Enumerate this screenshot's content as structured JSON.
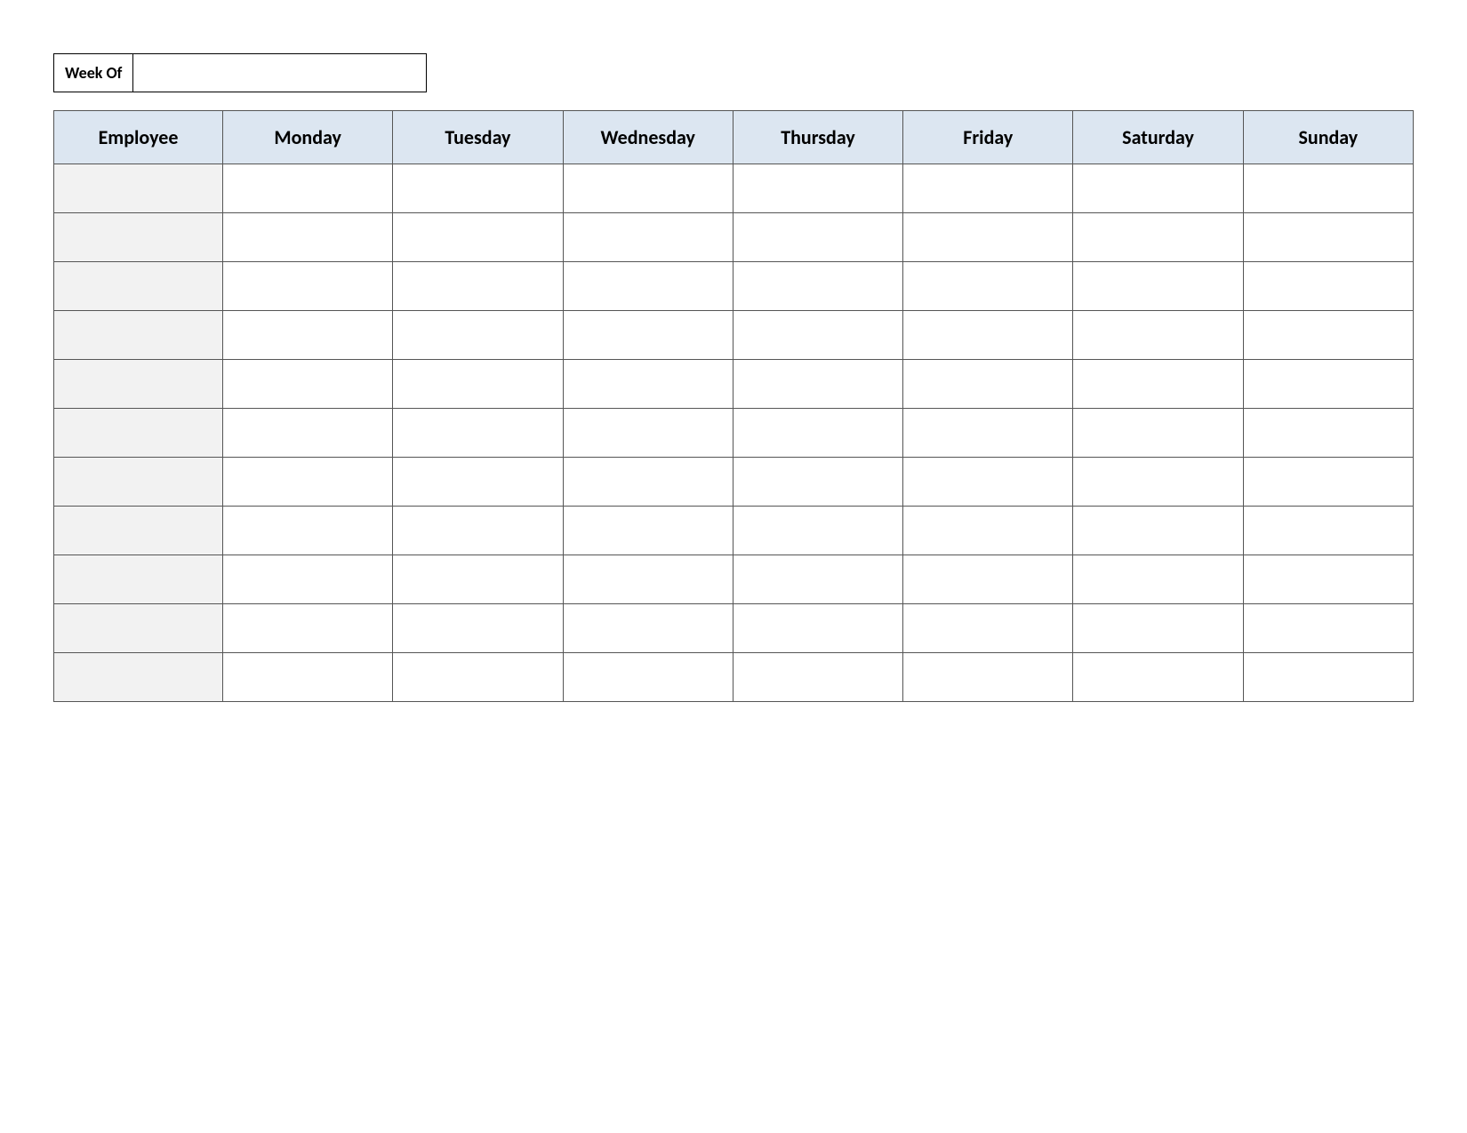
{
  "week_of": {
    "label": "Week Of",
    "value": ""
  },
  "headers": {
    "employee": "Employee",
    "days": [
      "Monday",
      "Tuesday",
      "Wednesday",
      "Thursday",
      "Friday",
      "Saturday",
      "Sunday"
    ]
  },
  "rows": [
    {
      "employee": "",
      "days": [
        "",
        "",
        "",
        "",
        "",
        "",
        ""
      ]
    },
    {
      "employee": "",
      "days": [
        "",
        "",
        "",
        "",
        "",
        "",
        ""
      ]
    },
    {
      "employee": "",
      "days": [
        "",
        "",
        "",
        "",
        "",
        "",
        ""
      ]
    },
    {
      "employee": "",
      "days": [
        "",
        "",
        "",
        "",
        "",
        "",
        ""
      ]
    },
    {
      "employee": "",
      "days": [
        "",
        "",
        "",
        "",
        "",
        "",
        ""
      ]
    },
    {
      "employee": "",
      "days": [
        "",
        "",
        "",
        "",
        "",
        "",
        ""
      ]
    },
    {
      "employee": "",
      "days": [
        "",
        "",
        "",
        "",
        "",
        "",
        ""
      ]
    },
    {
      "employee": "",
      "days": [
        "",
        "",
        "",
        "",
        "",
        "",
        ""
      ]
    },
    {
      "employee": "",
      "days": [
        "",
        "",
        "",
        "",
        "",
        "",
        ""
      ]
    },
    {
      "employee": "",
      "days": [
        "",
        "",
        "",
        "",
        "",
        "",
        ""
      ]
    },
    {
      "employee": "",
      "days": [
        "",
        "",
        "",
        "",
        "",
        "",
        ""
      ]
    }
  ]
}
